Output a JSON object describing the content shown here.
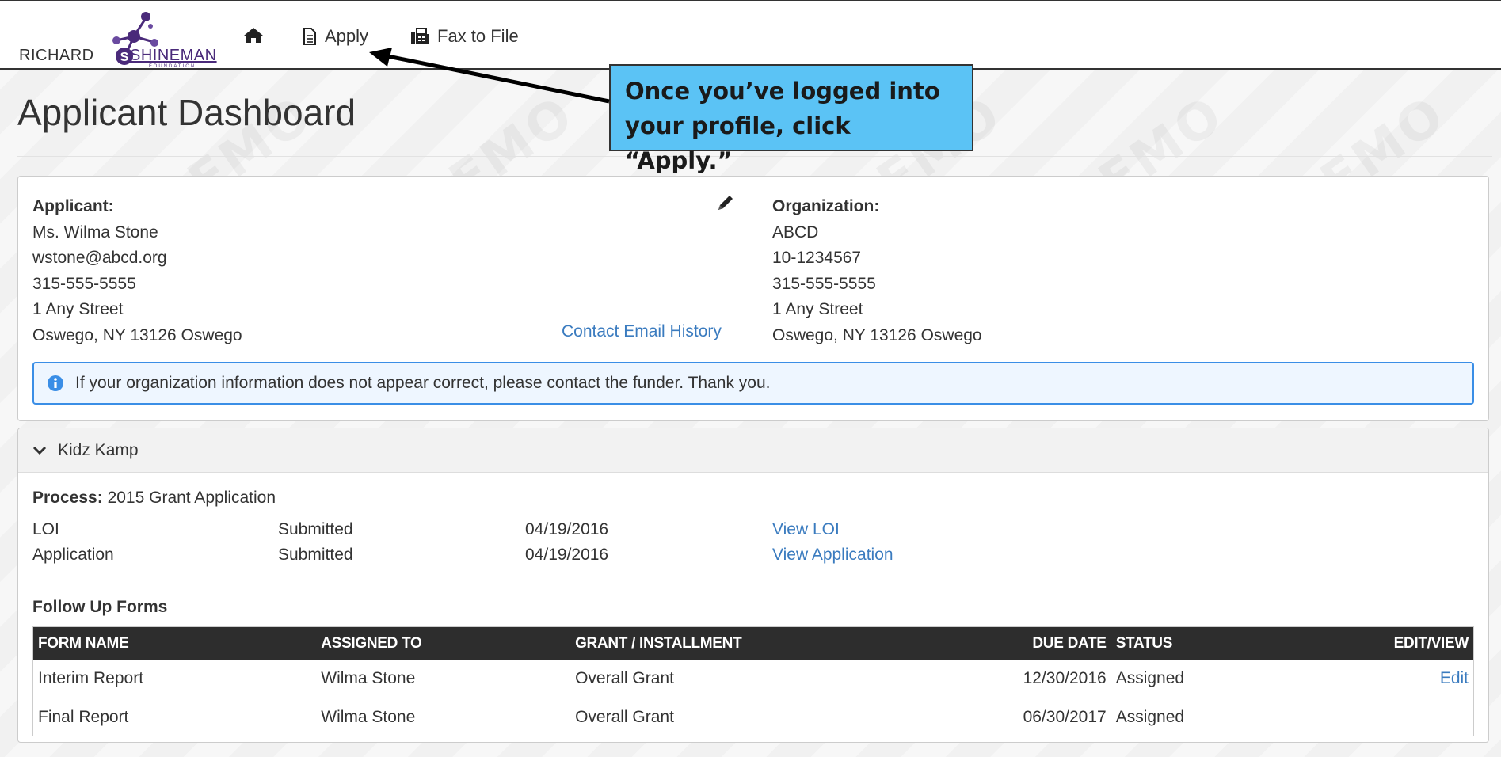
{
  "nav": {
    "logo": {
      "word1": "RICHARD",
      "word2": "SHINEMAN",
      "sub": "FOUNDATION"
    },
    "home_icon": "home-icon",
    "apply_label": "Apply",
    "fax_label": "Fax to File"
  },
  "page_title": "Applicant Dashboard",
  "callout": {
    "line1": "Once you’ve logged into",
    "line2": "your profile, click “Apply.”"
  },
  "applicant": {
    "label": "Applicant:",
    "name": "Ms. Wilma Stone",
    "email": "wstone@abcd.org",
    "phone": "315-555-5555",
    "street": "1 Any Street",
    "city": "Oswego, NY 13126 Oswego"
  },
  "contact_email_history": "Contact Email History",
  "organization": {
    "label": "Organization:",
    "name": "ABCD",
    "ein": "10-1234567",
    "phone": "315-555-5555",
    "street": "1 Any Street",
    "city": "Oswego, NY 13126 Oswego"
  },
  "alert_text": "If your organization information does not appear correct, please contact the funder. Thank you.",
  "project": {
    "name": "Kidz Kamp",
    "process_label": "Process:",
    "process_value": "2015 Grant Application",
    "steps": [
      {
        "name": "LOI",
        "status": "Submitted",
        "date": "04/19/2016",
        "link": "View LOI"
      },
      {
        "name": "Application",
        "status": "Submitted",
        "date": "04/19/2016",
        "link": "View Application"
      }
    ],
    "follow_up_label": "Follow Up Forms",
    "columns": [
      "FORM NAME",
      "ASSIGNED TO",
      "GRANT / INSTALLMENT",
      "DUE DATE",
      "STATUS",
      "EDIT/VIEW"
    ],
    "forms": [
      {
        "name": "Interim Report",
        "assigned": "Wilma Stone",
        "grant": "Overall Grant",
        "due": "12/30/2016",
        "status": "Assigned",
        "action": "Edit"
      },
      {
        "name": "Final Report",
        "assigned": "Wilma Stone",
        "grant": "Overall Grant",
        "due": "06/30/2017",
        "status": "Assigned",
        "action": ""
      }
    ]
  },
  "colors": {
    "callout_bg": "#5bc3f5",
    "link": "#3a7bbf",
    "alert_border": "#3a8ee6",
    "table_header": "#2d2d2d",
    "logo_purple": "#4a2a7a"
  }
}
